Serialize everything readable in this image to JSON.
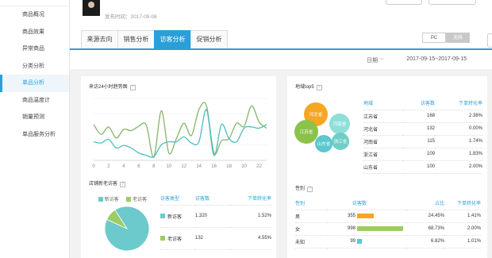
{
  "sidebar": {
    "items": [
      {
        "label": "商品概况",
        "active": false
      },
      {
        "label": "商品效果",
        "active": false
      },
      {
        "label": "异常商品",
        "active": false
      },
      {
        "label": "分类分析",
        "active": false
      },
      {
        "label": "单品分析",
        "active": true
      },
      {
        "label": "商品温度计",
        "active": false
      },
      {
        "label": "销量预测",
        "active": false
      },
      {
        "label": "单品服务分析",
        "active": false
      }
    ]
  },
  "header": {
    "publish_time": "发布时间：2017-09-06",
    "tabs": [
      "来源去向",
      "销售分析",
      "访客分析",
      "促销分析"
    ],
    "active_tab": 2,
    "device": {
      "pc": "PC",
      "wireless": "无线",
      "active": "wireless"
    }
  },
  "date_bar": {
    "label": "日期",
    "range": "2017-09-15~2017-09-15"
  },
  "trend": {
    "title": "来访24小时趋势图",
    "x_ticks": [
      "0",
      "2",
      "4",
      "6",
      "8",
      "10",
      "12",
      "14",
      "16",
      "18",
      "20",
      "22"
    ]
  },
  "region": {
    "title": "地域top5",
    "headers": [
      "地域",
      "访客数",
      "下单转化率"
    ],
    "rows": [
      {
        "region": "江苏省",
        "visitors": "168",
        "rate": "2.38%"
      },
      {
        "region": "河北省",
        "visitors": "132",
        "rate": "0.00%"
      },
      {
        "region": "河南省",
        "visitors": "115",
        "rate": "1.74%"
      },
      {
        "region": "浙江省",
        "visitors": "109",
        "rate": "1.83%"
      },
      {
        "region": "山东省",
        "visitors": "100",
        "rate": "2.00%"
      }
    ],
    "bubbles": [
      "河北省",
      "河南省",
      "江苏省",
      "山东省",
      "浙江省"
    ],
    "colors": {
      "hebei": "#f5a623",
      "henan": "#8de0d8",
      "jiangsu": "#8bc34a",
      "shandong": "#5bc7ce",
      "zhejiang": "#6fcfc7"
    }
  },
  "visitors": {
    "title": "店铺新老访客",
    "legend": [
      "新访客",
      "老访客"
    ],
    "headers": [
      "访客类型",
      "访客数",
      "下单转化率"
    ],
    "rows": [
      {
        "type": "新访客",
        "count": "1,320",
        "rate": "1.52%"
      },
      {
        "type": "老访客",
        "count": "132",
        "rate": "4.55%"
      }
    ],
    "colors": {
      "new": "#6cc9cc",
      "old": "#9ccc65"
    }
  },
  "gender": {
    "title": "性别",
    "headers": [
      "性别",
      "访客数",
      "占比",
      "下单转化率"
    ],
    "rows": [
      {
        "gender": "男",
        "count": "355",
        "share": "24.45%",
        "rate": "1.41%",
        "color": "#f5a623"
      },
      {
        "gender": "女",
        "count": "998",
        "share": "68.73%",
        "rate": "2.00%",
        "color": "#9ccc65"
      },
      {
        "gender": "未知",
        "count": "99",
        "share": "6.82%",
        "rate": "1.01%",
        "color": "#5bc7ce"
      }
    ]
  },
  "chart_data": [
    {
      "type": "line",
      "title": "来访24小时趋势图",
      "x": [
        0,
        1,
        2,
        3,
        4,
        5,
        6,
        7,
        8,
        9,
        10,
        11,
        12,
        13,
        14,
        15,
        16,
        17,
        18,
        19,
        20,
        21,
        22,
        23
      ],
      "ylim": [
        0,
        100
      ],
      "series": [
        {
          "color": "#86b56b",
          "values": [
            58,
            42,
            54,
            36,
            50,
            48,
            55,
            57,
            5,
            80,
            12,
            35,
            60,
            40,
            82,
            88,
            12,
            32,
            35,
            60,
            55,
            88,
            62,
            52
          ]
        },
        {
          "color": "#4cbdbf",
          "values": [
            30,
            28,
            34,
            20,
            24,
            20,
            12,
            8,
            6,
            25,
            30,
            30,
            38,
            28,
            30,
            82,
            8,
            58,
            35,
            30,
            52,
            54,
            52,
            58
          ]
        }
      ]
    },
    {
      "type": "pie",
      "title": "店铺新老访客",
      "categories": [
        "新访客",
        "老访客"
      ],
      "values": [
        1320,
        132
      ]
    },
    {
      "type": "bar",
      "title": "性别",
      "categories": [
        "男",
        "女",
        "未知"
      ],
      "values": [
        355,
        998,
        99
      ]
    }
  ]
}
